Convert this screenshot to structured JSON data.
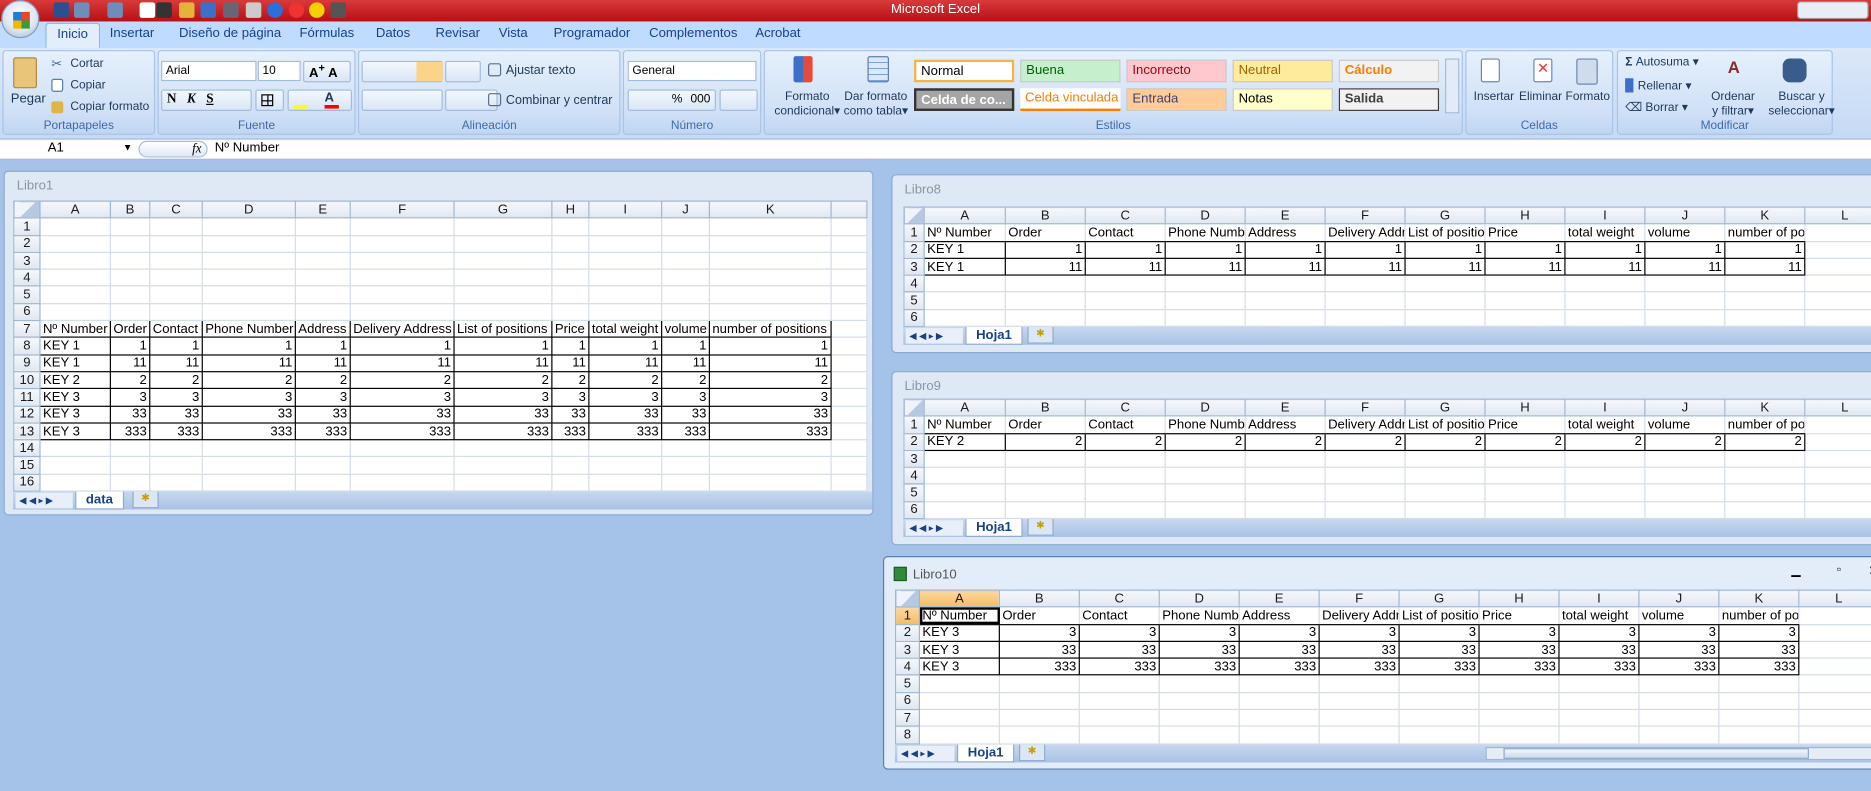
{
  "app": {
    "title": "Microsoft Excel"
  },
  "quick_access": [
    "save-icon",
    "undo-icon",
    "redo-icon",
    "new-icon",
    "filter-icon",
    "form-icon",
    "table-icon",
    "print-icon",
    "print-preview-icon",
    "record-icon",
    "close-red-icon",
    "smiley-icon",
    "camera-icon"
  ],
  "ribbon_tabs": [
    {
      "label": "Inicio",
      "active": true
    },
    {
      "label": "Insertar"
    },
    {
      "label": "Diseño de página"
    },
    {
      "label": "Fórmulas"
    },
    {
      "label": "Datos"
    },
    {
      "label": "Revisar"
    },
    {
      "label": "Vista"
    },
    {
      "label": "Programador"
    },
    {
      "label": "Complementos"
    },
    {
      "label": "Acrobat"
    }
  ],
  "ribbon": {
    "clipboard": {
      "label": "Portapapeles",
      "paste": "Pegar",
      "cut": "Cortar",
      "copy": "Copiar",
      "format_painter": "Copiar formato"
    },
    "font": {
      "label": "Fuente",
      "font_name": "Arial",
      "font_size": "10",
      "bold": "N",
      "italic": "K",
      "underline": "S",
      "highlight_color": "#ffff00",
      "font_color": "#ff0000"
    },
    "alignment": {
      "label": "Alineación",
      "wrap_text": "Ajustar texto",
      "merge_center": "Combinar y centrar"
    },
    "number": {
      "label": "Número",
      "format": "General",
      "percent": "%",
      "thousands": "000"
    },
    "styles": {
      "label": "Estilos",
      "conditional": [
        "Formato",
        "condicional"
      ],
      "as_table": [
        "Dar formato",
        "como tabla"
      ],
      "gallery": [
        {
          "label": "Normal",
          "bg": "#ffffff",
          "color": "#000000"
        },
        {
          "label": "Buena",
          "bg": "#c6efce",
          "color": "#006100"
        },
        {
          "label": "Incorrecto",
          "bg": "#ffc7ce",
          "color": "#9c0006"
        },
        {
          "label": "Neutral",
          "bg": "#ffeb9c",
          "color": "#9c6500"
        },
        {
          "label": "Cálculo",
          "bg": "#f2f2f2",
          "color": "#fa7d00"
        },
        {
          "label": "Celda de co...",
          "bg": "#a5a5a5",
          "color": "#ffffff"
        },
        {
          "label": "Celda vinculada",
          "bg": "#ffffff",
          "color": "#fa7d00"
        },
        {
          "label": "Entrada",
          "bg": "#ffcc99",
          "color": "#3f3f76"
        },
        {
          "label": "Notas",
          "bg": "#ffffcc",
          "color": "#000000"
        },
        {
          "label": "Salida",
          "bg": "#f2f2f2",
          "color": "#3f3f3f"
        }
      ]
    },
    "cells": {
      "label": "Celdas",
      "insert": "Insertar",
      "delete": "Eliminar",
      "format": "Formato"
    },
    "editing": {
      "label": "Modificar",
      "autosum": "Autosuma",
      "fill": "Rellenar",
      "clear": "Borrar",
      "sort": [
        "Ordenar",
        "y filtrar"
      ],
      "find": [
        "Buscar y",
        "seleccionar"
      ]
    }
  },
  "formula_bar": {
    "name_box": "A1",
    "fx": "fx",
    "content": "Nº Number"
  },
  "workbooks": [
    {
      "title": "Libro1",
      "sheet_tab": "data",
      "columns": [
        "A",
        "B",
        "C",
        "D",
        "E",
        "F",
        "G",
        "H",
        "I",
        "J",
        "K",
        ""
      ],
      "row_count": 16,
      "header_row": 7,
      "headers": [
        "Nº Number",
        "Order",
        "Contact",
        "Phone Number",
        "Address",
        "Delivery Address",
        "List of positions",
        "Price",
        "total weight",
        "volume",
        "number of positions"
      ],
      "rows": [
        [
          "KEY 1",
          1,
          1,
          1,
          1,
          1,
          1,
          1,
          1,
          1,
          1
        ],
        [
          "KEY 1",
          11,
          11,
          11,
          11,
          11,
          11,
          11,
          11,
          11,
          11
        ],
        [
          "KEY 2",
          2,
          2,
          2,
          2,
          2,
          2,
          2,
          2,
          2,
          2
        ],
        [
          "KEY 3",
          3,
          3,
          3,
          3,
          3,
          3,
          3,
          3,
          3,
          3
        ],
        [
          "KEY 3",
          33,
          33,
          33,
          33,
          33,
          33,
          33,
          33,
          33,
          33
        ],
        [
          "KEY 3",
          333,
          333,
          333,
          333,
          333,
          333,
          333,
          333,
          333,
          333
        ]
      ]
    },
    {
      "title": "Libro8",
      "sheet_tab": "Hoja1",
      "columns": [
        "A",
        "B",
        "C",
        "D",
        "E",
        "F",
        "G",
        "H",
        "I",
        "J",
        "K",
        "L"
      ],
      "row_count": 6,
      "header_row": 1,
      "headers": [
        "Nº Number",
        "Order",
        "Contact",
        "Phone Numb",
        "Address",
        "Delivery Addr",
        "List of positio",
        "Price",
        "total weight",
        "volume",
        "number of positions"
      ],
      "rows": [
        [
          "KEY 1",
          1,
          1,
          1,
          1,
          1,
          1,
          1,
          1,
          1,
          1
        ],
        [
          "KEY 1",
          11,
          11,
          11,
          11,
          11,
          11,
          11,
          11,
          11,
          11
        ]
      ]
    },
    {
      "title": "Libro9",
      "sheet_tab": "Hoja1",
      "columns": [
        "A",
        "B",
        "C",
        "D",
        "E",
        "F",
        "G",
        "H",
        "I",
        "J",
        "K",
        "L"
      ],
      "row_count": 6,
      "header_row": 1,
      "headers": [
        "Nº Number",
        "Order",
        "Contact",
        "Phone Numb",
        "Address",
        "Delivery Addr",
        "List of positio",
        "Price",
        "total weight",
        "volume",
        "number of positions"
      ],
      "rows": [
        [
          "KEY 2",
          2,
          2,
          2,
          2,
          2,
          2,
          2,
          2,
          2,
          2
        ]
      ]
    },
    {
      "title": "Libro10",
      "sheet_tab": "Hoja1",
      "active": true,
      "selected_cell": "A1",
      "columns": [
        "A",
        "B",
        "C",
        "D",
        "E",
        "F",
        "G",
        "H",
        "I",
        "J",
        "K",
        "L"
      ],
      "row_count": 8,
      "header_row": 1,
      "headers": [
        "Nº Number",
        "Order",
        "Contact",
        "Phone Numb",
        "Address",
        "Delivery Addr",
        "List of positio",
        "Price",
        "total weight",
        "volume",
        "number of positions"
      ],
      "rows": [
        [
          "KEY 3",
          3,
          3,
          3,
          3,
          3,
          3,
          3,
          3,
          3,
          3
        ],
        [
          "KEY 3",
          33,
          33,
          33,
          33,
          33,
          33,
          33,
          33,
          33,
          33
        ],
        [
          "KEY 3",
          333,
          333,
          333,
          333,
          333,
          333,
          333,
          333,
          333,
          333
        ]
      ]
    }
  ]
}
